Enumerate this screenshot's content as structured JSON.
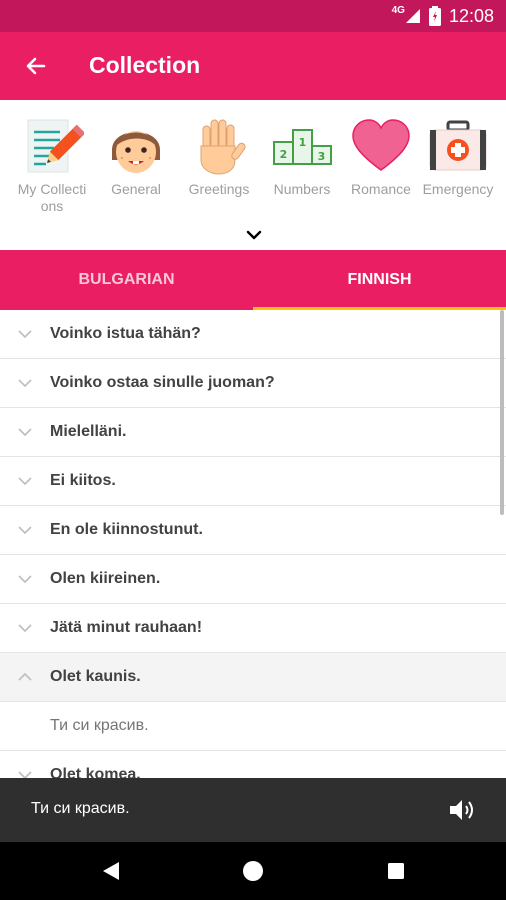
{
  "status_bar": {
    "network": "4G",
    "time": "12:08"
  },
  "app_bar": {
    "title": "Collection"
  },
  "categories": [
    {
      "label": "My Collections",
      "icon": "notepad-pencil-icon"
    },
    {
      "label": "General",
      "icon": "face-icon"
    },
    {
      "label": "Greetings",
      "icon": "hand-icon"
    },
    {
      "label": "Numbers",
      "icon": "podium-icon"
    },
    {
      "label": "Romance",
      "icon": "heart-icon"
    },
    {
      "label": "Emergency",
      "icon": "first-aid-kit-icon"
    }
  ],
  "tabs": [
    {
      "label": "BULGARIAN",
      "selected": false
    },
    {
      "label": "FINNISH",
      "selected": true
    }
  ],
  "phrases": [
    {
      "text": "Voinko istua tähän?"
    },
    {
      "text": "Voinko ostaa sinulle juoman?"
    },
    {
      "text": "Mielelläni."
    },
    {
      "text": "Ei kiitos."
    },
    {
      "text": "En ole kiinnostunut."
    },
    {
      "text": "Olen kiireinen."
    },
    {
      "text": "Jätä minut rauhaan!"
    },
    {
      "text": "Olet kaunis.",
      "translation": "Ти си красив."
    },
    {
      "text": "Olet komea."
    }
  ],
  "player": {
    "text": "Ти си красив."
  },
  "colors": {
    "primary": "#e91e63",
    "status_bar": "#c2185b",
    "tab_indicator": "#ffc107",
    "player_bg": "#2f2f2f"
  }
}
